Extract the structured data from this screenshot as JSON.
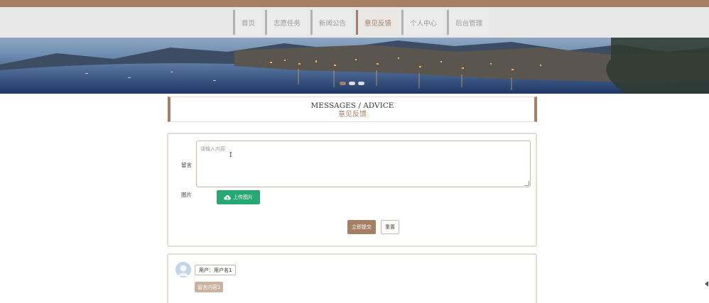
{
  "nav": {
    "items": [
      {
        "label": "首页",
        "active": false
      },
      {
        "label": "志愿任务",
        "active": false
      },
      {
        "label": "新闻公告",
        "active": false
      },
      {
        "label": "意见反馈",
        "active": true
      },
      {
        "label": "个人中心",
        "active": false
      },
      {
        "label": "后台管理",
        "active": false
      }
    ]
  },
  "banner": {
    "slide_count": 3,
    "active_slide": 1
  },
  "section": {
    "title_en": "MESSAGES / ADVICE",
    "title_cn": "意见反馈"
  },
  "form": {
    "message_label": "留言",
    "message_placeholder": "请输入内容",
    "image_label": "图片",
    "upload_label": "上传图片",
    "submit_label": "立即提交",
    "reset_label": "重置"
  },
  "messages": [
    {
      "user": "用户：用户名1",
      "content": "留言内容1"
    }
  ],
  "colors": {
    "accent": "#a57e63",
    "upload": "#26a872"
  }
}
